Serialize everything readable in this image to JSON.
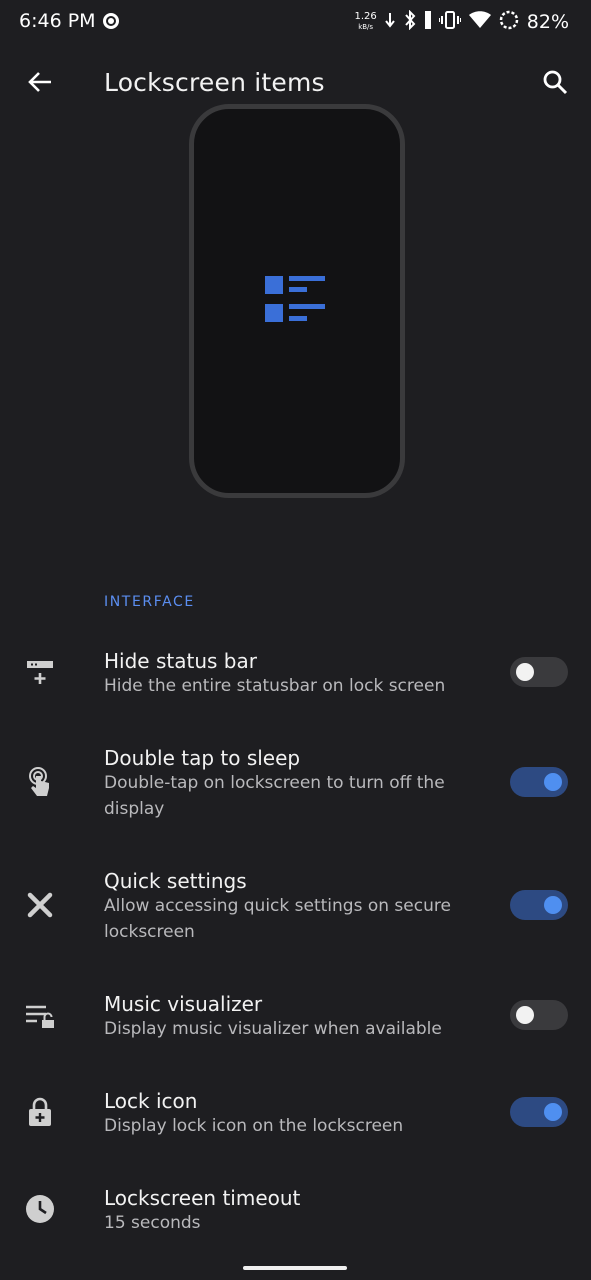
{
  "status_bar": {
    "time": "6:46 PM",
    "net_speed_value": "1.26",
    "net_speed_unit": "kB/s",
    "battery": "82%",
    "icons": [
      "record-icon",
      "download-icon",
      "bluetooth-icon",
      "vibrate-icon",
      "wifi-icon",
      "battery-saver-icon"
    ]
  },
  "app_bar": {
    "title": "Lockscreen items",
    "back_icon": "arrow-back-icon",
    "search_icon": "search-icon"
  },
  "preview": {
    "icon": "lockscreen-items-icon",
    "accent": "#3a6fd8"
  },
  "section": {
    "header": "INTERFACE"
  },
  "settings": [
    {
      "title": "Hide status bar",
      "summary": "Hide the entire statusbar on lock screen",
      "icon": "status-bar-icon",
      "enabled": false
    },
    {
      "title": "Double tap to sleep",
      "summary": "Double-tap on lockscreen to turn off the display",
      "icon": "double-tap-icon",
      "enabled": true
    },
    {
      "title": "Quick settings",
      "summary": "Allow accessing quick settings on secure lockscreen",
      "icon": "tools-icon",
      "enabled": true
    },
    {
      "title": "Music visualizer",
      "summary": "Display music visualizer when available",
      "icon": "playlist-lock-icon",
      "enabled": false
    },
    {
      "title": "Lock icon",
      "summary": "Display lock icon on the lockscreen",
      "icon": "lock-icon",
      "enabled": true
    },
    {
      "title": "Lockscreen timeout",
      "summary": "15 seconds",
      "icon": "clock-icon"
    }
  ],
  "colors": {
    "background": "#1e1e21",
    "accent": "#5b8ef0",
    "switch_on_track": "#2d4a82",
    "switch_on_thumb": "#4f8ff0"
  }
}
